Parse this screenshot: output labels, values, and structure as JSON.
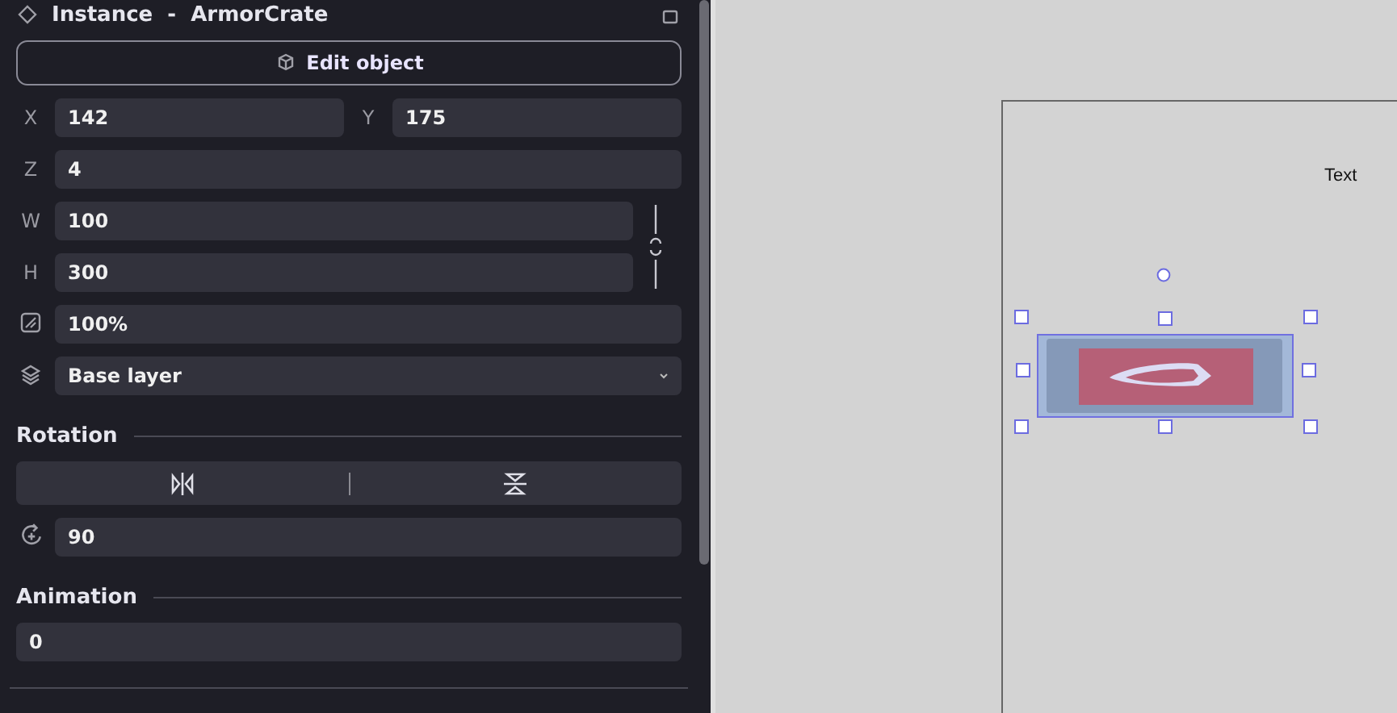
{
  "panel": {
    "title": "Instance  -  ArmorCrate",
    "edit_button": {
      "label": "Edit object"
    },
    "position": [
      {
        "label": "X",
        "value": "142"
      },
      {
        "label": "Y",
        "value": "175"
      }
    ],
    "z": {
      "label": "Z",
      "value": "4"
    },
    "size": [
      {
        "label": "W",
        "value": "100"
      },
      {
        "label": "H",
        "value": "300"
      }
    ],
    "opacity": {
      "value": "100%"
    },
    "layer": {
      "value": "Base layer"
    },
    "rotation": {
      "heading": "Rotation",
      "angle": "90"
    },
    "animation": {
      "heading": "Animation",
      "value": "0"
    }
  },
  "canvas": {
    "text_object": "Text"
  }
}
